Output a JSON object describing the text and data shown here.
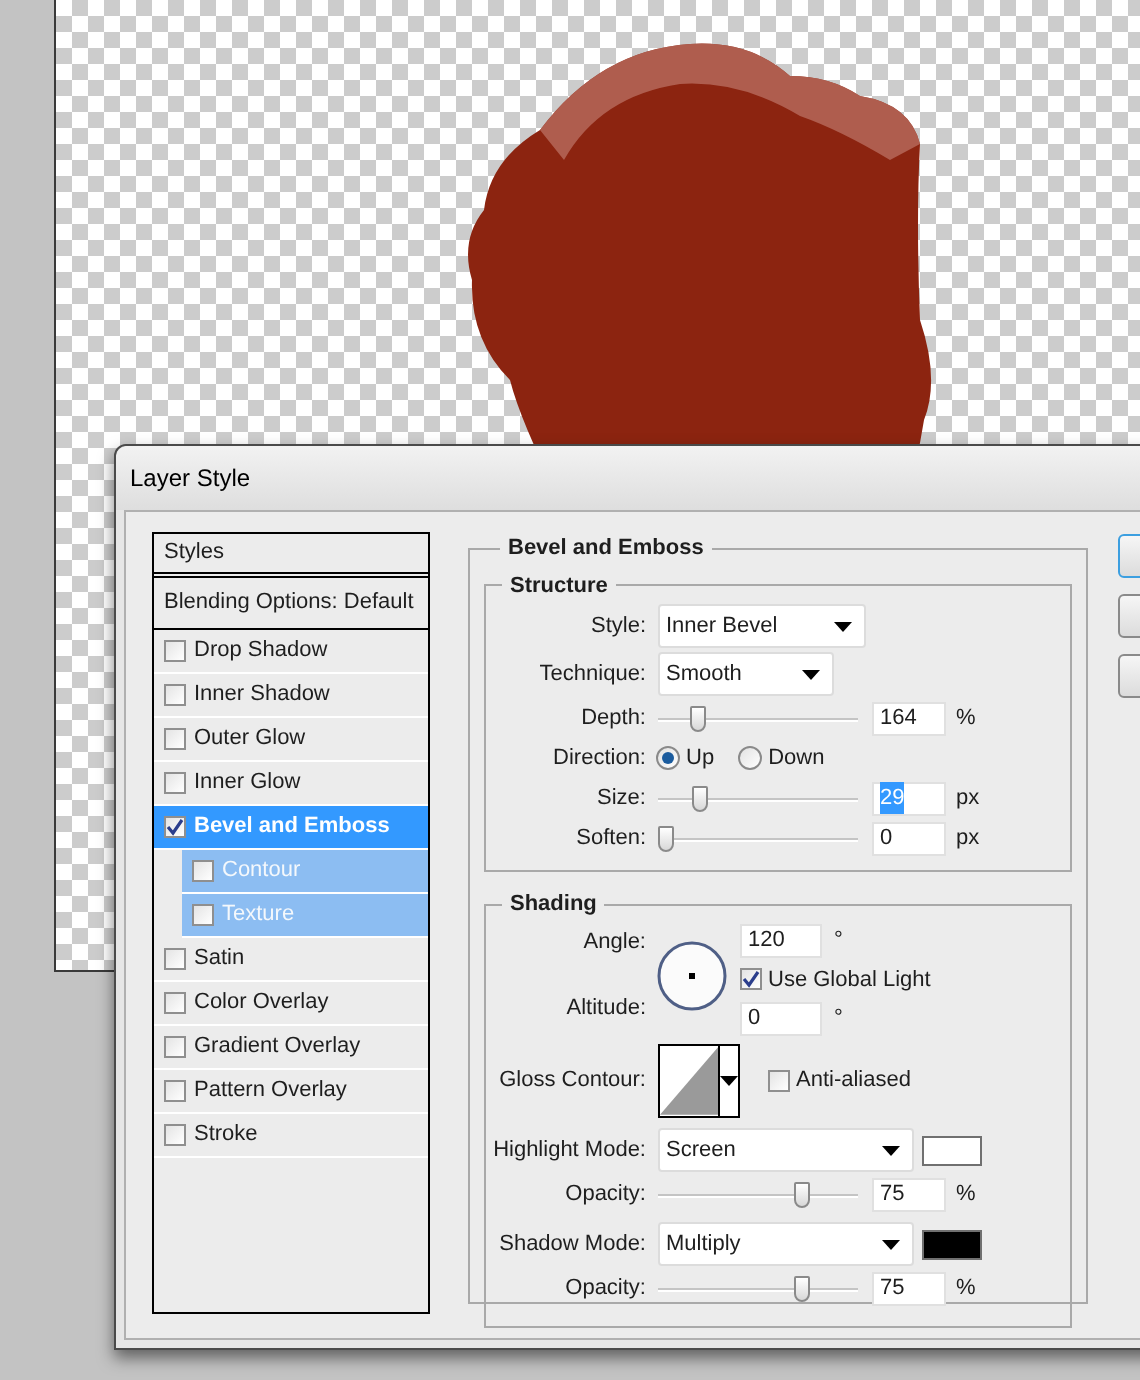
{
  "window": {
    "title": "Layer Style"
  },
  "styles_list": {
    "header": "Styles",
    "blending_options": "Blending Options: Default",
    "items": [
      {
        "label": "Drop Shadow",
        "checked": false,
        "selected": false
      },
      {
        "label": "Inner Shadow",
        "checked": false,
        "selected": false
      },
      {
        "label": "Outer Glow",
        "checked": false,
        "selected": false
      },
      {
        "label": "Inner Glow",
        "checked": false,
        "selected": false
      },
      {
        "label": "Bevel and Emboss",
        "checked": true,
        "selected": true,
        "children": [
          {
            "label": "Contour",
            "checked": false,
            "selected": false
          },
          {
            "label": "Texture",
            "checked": false,
            "selected": false
          }
        ]
      },
      {
        "label": "Satin",
        "checked": false,
        "selected": false
      },
      {
        "label": "Color Overlay",
        "checked": false,
        "selected": false
      },
      {
        "label": "Gradient Overlay",
        "checked": false,
        "selected": false
      },
      {
        "label": "Pattern Overlay",
        "checked": false,
        "selected": false
      },
      {
        "label": "Stroke",
        "checked": false,
        "selected": false
      }
    ]
  },
  "bevel_and_emboss": {
    "title": "Bevel and Emboss",
    "structure": {
      "title": "Structure",
      "style": {
        "label": "Style:",
        "value": "Inner Bevel"
      },
      "technique": {
        "label": "Technique:",
        "value": "Smooth"
      },
      "depth": {
        "label": "Depth:",
        "value": "164",
        "unit": "%",
        "level": 0.17,
        "text_selected": false
      },
      "direction": {
        "label": "Direction:",
        "options": [
          {
            "label": "Up",
            "selected": true
          },
          {
            "label": "Down",
            "selected": false
          }
        ]
      },
      "size": {
        "label": "Size:",
        "value": "29",
        "unit": "px",
        "level": 0.18,
        "text_selected": true
      },
      "soften": {
        "label": "Soften:",
        "value": "0",
        "unit": "px",
        "level": 0,
        "text_selected": false
      }
    },
    "shading": {
      "title": "Shading",
      "angle": {
        "label": "Angle:",
        "value": "120",
        "unit": "°"
      },
      "use_global_light": {
        "label": "Use Global Light",
        "checked": true
      },
      "altitude": {
        "label": "Altitude:",
        "value": "0",
        "unit": "°"
      },
      "gloss_contour": {
        "label": "Gloss Contour:"
      },
      "anti_aliased": {
        "label": "Anti-aliased",
        "checked": false
      },
      "highlight_mode": {
        "label": "Highlight Mode:",
        "value": "Screen",
        "color": "#ffffff"
      },
      "highlight_opacity": {
        "label": "Opacity:",
        "value": "75",
        "unit": "%",
        "level": 0.74,
        "text_selected": false
      },
      "shadow_mode": {
        "label": "Shadow Mode:",
        "value": "Multiply",
        "color": "#000000"
      },
      "shadow_opacity": {
        "label": "Opacity:",
        "value": "75",
        "unit": "%",
        "level": 0.74,
        "text_selected": false
      }
    }
  },
  "buttons": [
    {
      "default": true
    },
    {
      "default": false
    },
    {
      "default": false
    }
  ]
}
